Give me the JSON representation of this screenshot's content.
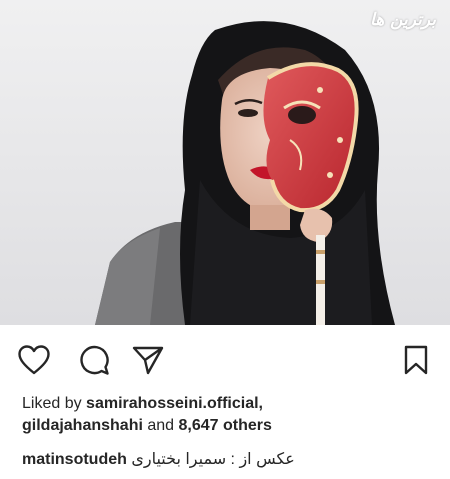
{
  "photo": {
    "watermark_text": "برترین ها",
    "background_color": "#e8e8ea"
  },
  "actions": {
    "like_icon": "heart-outline-icon",
    "comment_icon": "comment-bubble-icon",
    "share_icon": "paper-plane-icon",
    "save_icon": "bookmark-icon"
  },
  "likes": {
    "prefix": "Liked by",
    "user1": "samirahosseini.official,",
    "user2": "gildajahanshahi",
    "middle": "and",
    "others": "8,647 others"
  },
  "caption": {
    "username": "matinsotudeh",
    "text": "عکس از : سمیرا بختیاری"
  }
}
